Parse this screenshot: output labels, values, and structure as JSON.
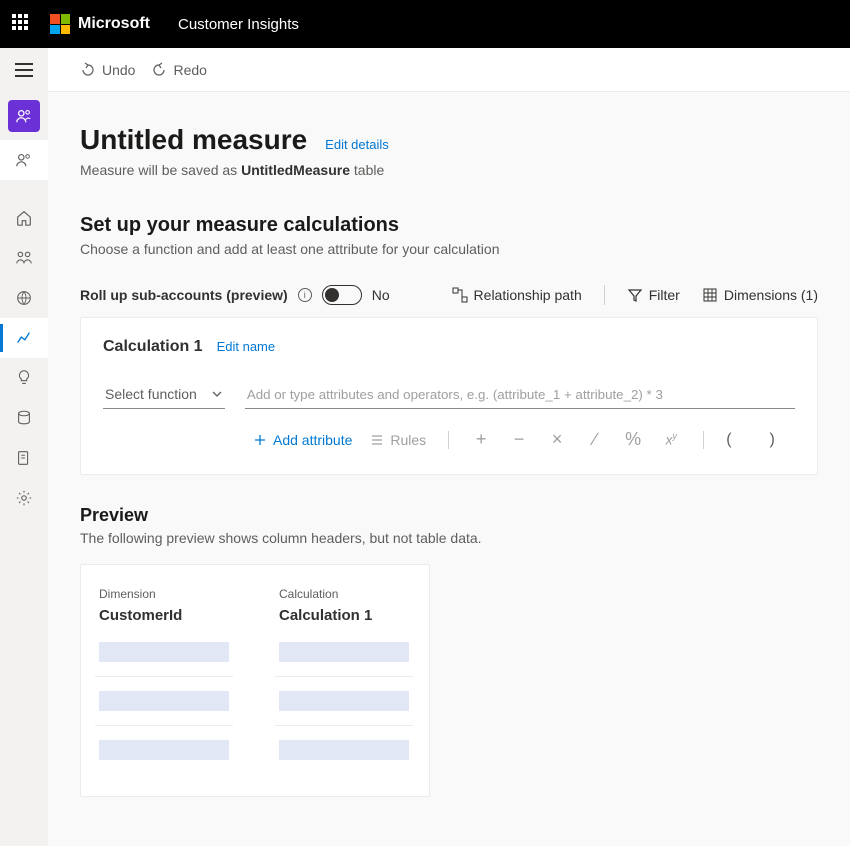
{
  "header": {
    "brand": "Microsoft",
    "product": "Customer Insights"
  },
  "commands": {
    "undo": "Undo",
    "redo": "Redo"
  },
  "page": {
    "title": "Untitled measure",
    "edit_details": "Edit details",
    "saved_as_prefix": "Measure will be saved as ",
    "saved_as_name": "UntitledMeasure",
    "saved_as_suffix": " table"
  },
  "section": {
    "title": "Set up your measure calculations",
    "sub": "Choose a function and add at least one attribute for your calculation"
  },
  "controls": {
    "rollup_label": "Roll up sub-accounts (preview)",
    "toggle_value": "No",
    "relationship": "Relationship path",
    "filter": "Filter",
    "dimensions": "Dimensions (1)"
  },
  "calc": {
    "title": "Calculation 1",
    "edit_name": "Edit name",
    "select_fn": "Select function",
    "formula_placeholder": "Add or type attributes and operators, e.g. (attribute_1 + attribute_2) * 3",
    "add_attr": "Add attribute",
    "rules": "Rules"
  },
  "preview": {
    "title": "Preview",
    "sub": "The following preview shows column headers, but not table data.",
    "dim_label": "Dimension",
    "calc_label": "Calculation",
    "dim_value": "CustomerId",
    "calc_value": "Calculation 1"
  }
}
